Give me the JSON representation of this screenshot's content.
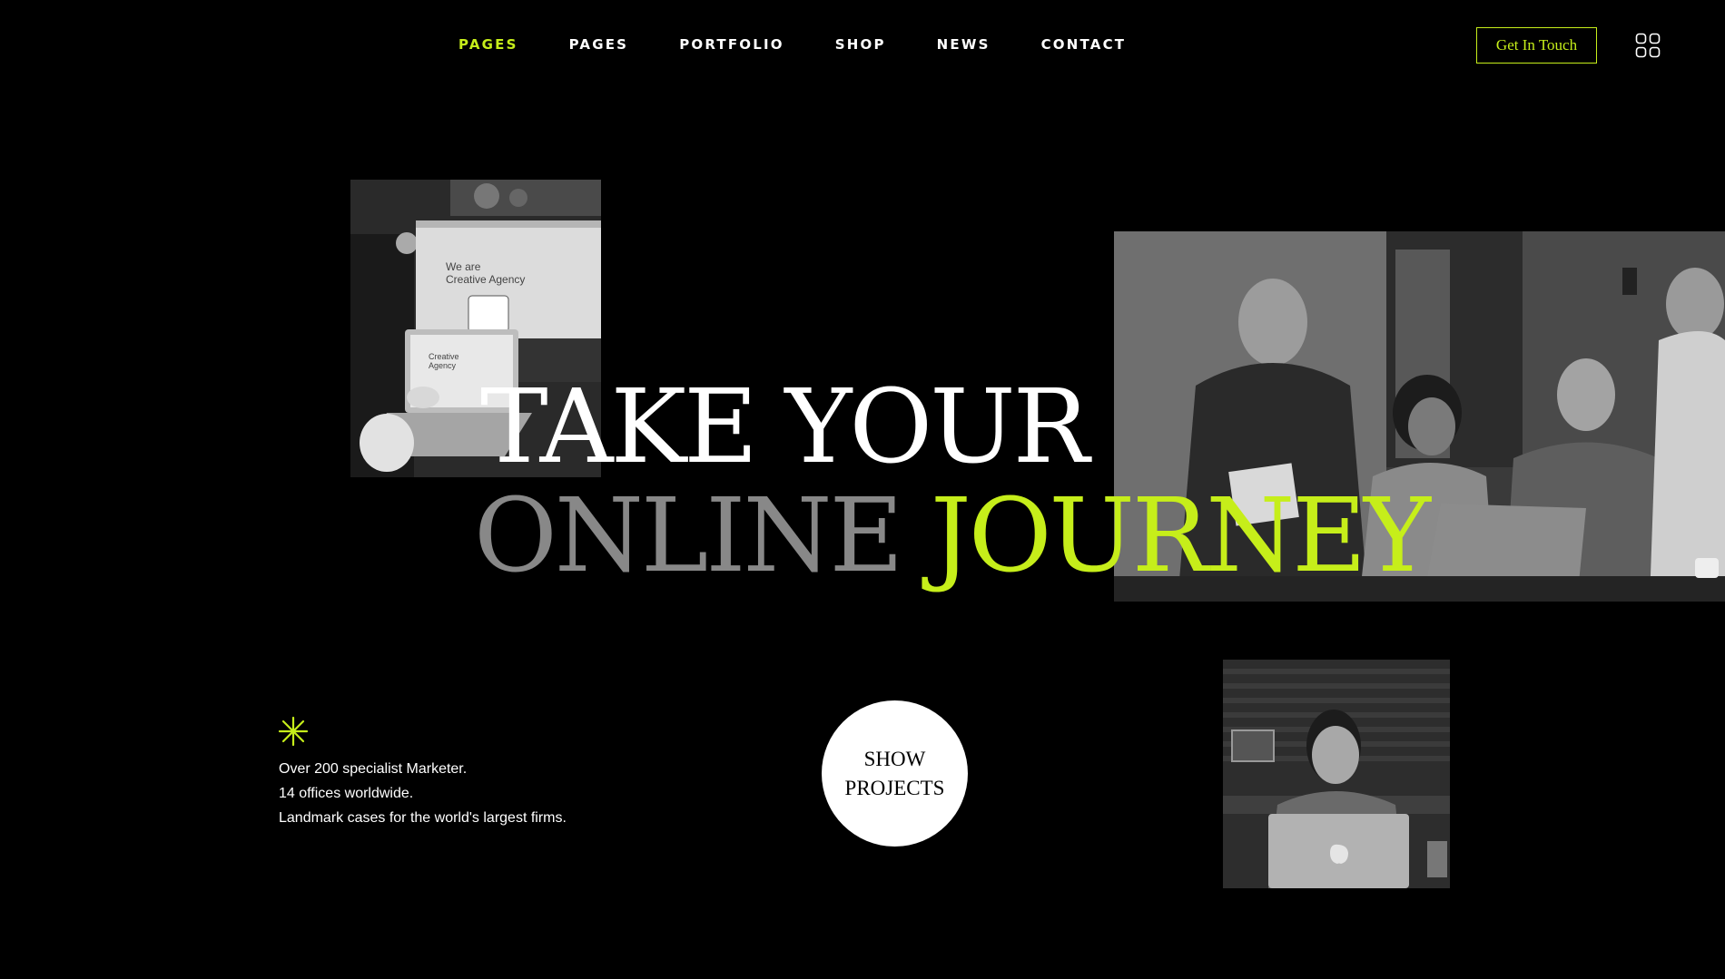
{
  "nav": {
    "items": [
      "PAGES",
      "PAGES",
      "PORTFOLIO",
      "SHOP",
      "NEWS",
      "CONTACT"
    ]
  },
  "header": {
    "cta_label": "Get In Touch",
    "menu_icon": "grid-icon",
    "accent_color": "#c6ee1a"
  },
  "hero": {
    "line1": "TAKE YOUR",
    "line2_muted": "ONLINE",
    "line2_accent": "JOURNEY",
    "laptop_screen_line1": "We are",
    "laptop_screen_line2": "Creative Agency",
    "laptop_small_line1": "Creative",
    "laptop_small_line2": "Agency"
  },
  "stats": {
    "icon": "asterisk-icon",
    "lines": [
      "Over 200 specialist Marketer.",
      "14 offices worldwide.",
      "Landmark cases for the world's largest firms."
    ]
  },
  "show_projects": {
    "line1": "SHOW",
    "line2": "PROJECTS"
  }
}
